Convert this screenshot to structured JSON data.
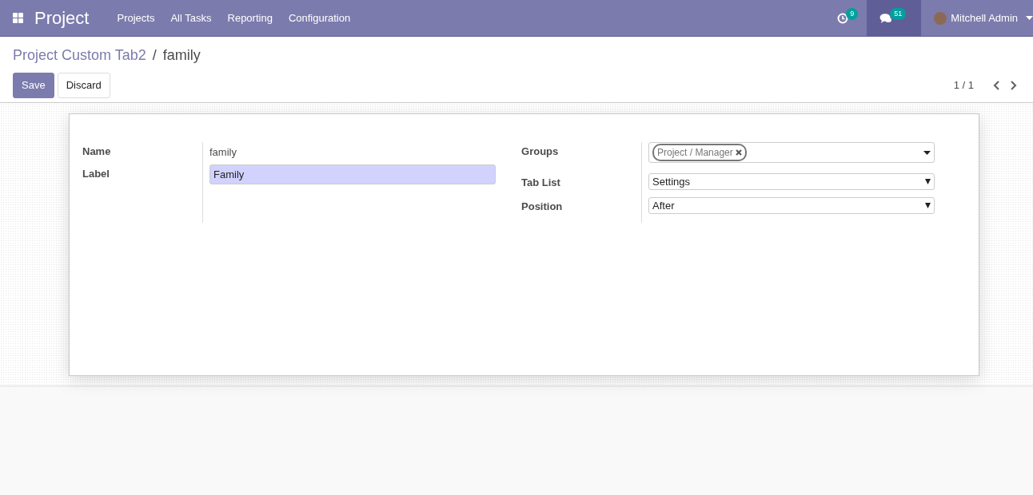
{
  "navbar": {
    "app_name": "Project",
    "menu": [
      "Projects",
      "All Tasks",
      "Reporting",
      "Configuration"
    ],
    "activity_count": "9",
    "message_count": "51",
    "messages_selected": true,
    "user": "Mitchell Admin"
  },
  "breadcrumb": {
    "items": [
      "Project Custom Tab2",
      "family"
    ],
    "separator": "/"
  },
  "buttons": [
    {
      "label": "Save",
      "kind": "primary"
    },
    {
      "label": "Discard",
      "kind": "secondary"
    }
  ],
  "pager": "1 / 1",
  "form": {
    "left": [
      {
        "label": "Name",
        "kind": "text",
        "value": "family"
      },
      {
        "label": "Label",
        "kind": "input",
        "value": "Family",
        "focused": true
      }
    ],
    "right": [
      {
        "label": "Groups",
        "kind": "tags",
        "tags": [
          "Project / Manager"
        ]
      },
      {
        "label": "Tab List",
        "kind": "select",
        "value": "Settings"
      },
      {
        "label": "Position",
        "kind": "select",
        "value": "After"
      }
    ]
  }
}
